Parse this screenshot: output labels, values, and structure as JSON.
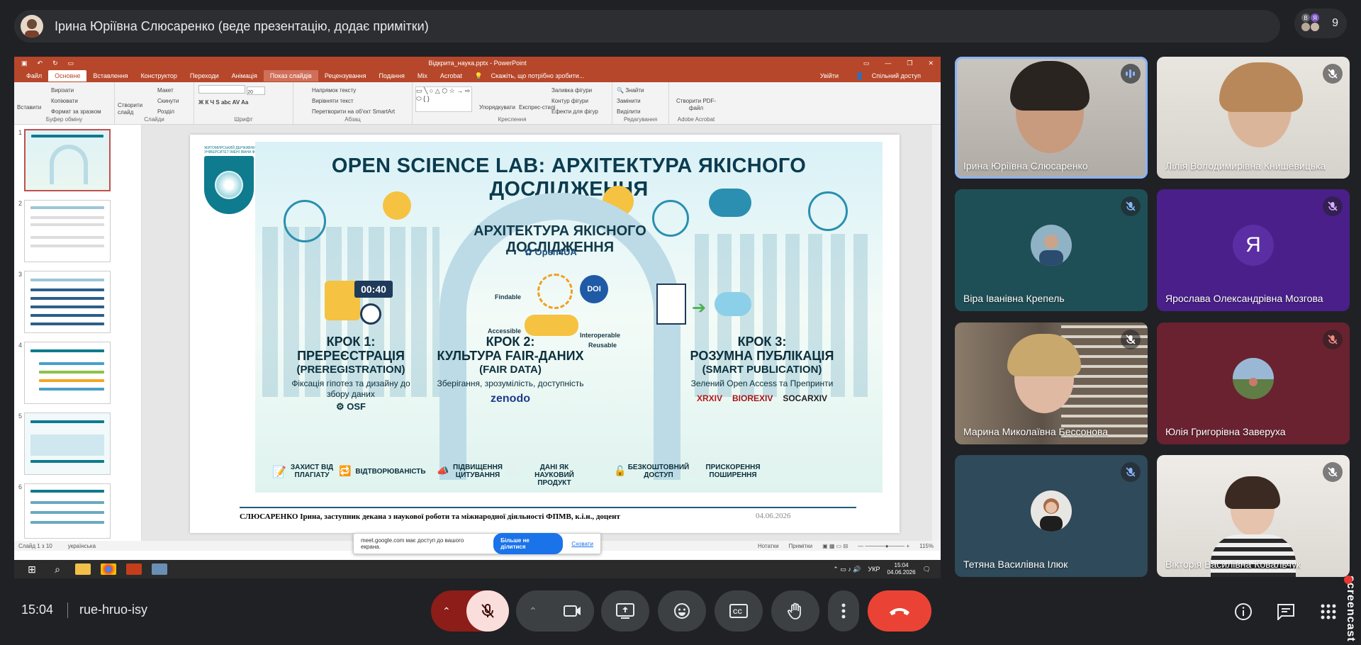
{
  "meet": {
    "presenter_title": "Ірина Юріївна Слюсаренко (веде презентацію, додає примітки)",
    "participant_count": "9",
    "participant_initials": [
      "В",
      "Я"
    ],
    "time": "15:04",
    "meeting_code": "rue-hruo-isy"
  },
  "tiles": [
    {
      "name": "Ірина Юріївна Слюсаренко",
      "status": "speaking"
    },
    {
      "name": "Лілія Володимирівна Книшевицька",
      "status": "muted"
    },
    {
      "name": "Віра Іванівна Крепель",
      "status": "muted"
    },
    {
      "name": "Ярослава Олександрівна Мозгова",
      "status": "muted",
      "initial": "Я"
    },
    {
      "name": "Марина Миколаївна Бессонова",
      "status": "muted"
    },
    {
      "name": "Юлія Григорівна Заверуха",
      "status": "muted"
    },
    {
      "name": "Тетяна Василівна Ілюк",
      "status": "muted"
    },
    {
      "name": "Вікторія Василівна Ковальчук",
      "status": "muted"
    }
  ],
  "screencast_label": "screencast",
  "powerpoint": {
    "window_title": "Відкрита_наука.pptx - PowerPoint",
    "menu": [
      "Файл",
      "Основне",
      "Вставлення",
      "Конструктор",
      "Переходи",
      "Анімація",
      "Показ слайдів",
      "Рецензування",
      "Подання",
      "Mix",
      "Acrobat"
    ],
    "tell_me": "Скажіть, що потрібно зробити...",
    "signin": "Увійти",
    "share": "Спільний доступ",
    "ribbon": {
      "clipboard": {
        "label": "Буфер обміну",
        "paste": "Вставити",
        "cut": "Вирізати",
        "copy": "Копіювати",
        "format": "Формат за зразком"
      },
      "slides": {
        "label": "Слайди",
        "new": "Створити слайд",
        "layout": "Макет",
        "reset": "Скинути",
        "section": "Розділ"
      },
      "font": {
        "label": "Шрифт",
        "size": "20"
      },
      "paragraph": {
        "label": "Абзац",
        "dir": "Напрямок тексту",
        "align": "Вирівняти текст",
        "smartart": "Перетворити на об'єкт SmartArt"
      },
      "drawing": {
        "label": "Креслення",
        "arrange": "Упорядкувати",
        "styles": "Експрес-стилі",
        "fill": "Заливка фігури",
        "outline": "Контур фігури",
        "effects": "Ефекти для фігур"
      },
      "editing": {
        "label": "Редагування",
        "find": "Знайти",
        "replace": "Замінити",
        "select": "Виділити"
      },
      "acrobat": {
        "label": "Adobe Acrobat",
        "create": "Створити PDF-файл"
      }
    },
    "thumb_numbers": [
      "1",
      "2",
      "3",
      "4",
      "5",
      "6"
    ],
    "status_slide": "Слайд 1 з 10",
    "status_lang": "українська",
    "status_notes": "Нотатки",
    "status_comments": "Примітки",
    "status_zoom": "115%",
    "share_notice": {
      "text": "meet.google.com має доступ до вашого екрана.",
      "stop": "Більше не ділитися",
      "hide": "Сховати"
    },
    "tray_lang": "УКР",
    "tray_time": "15:04",
    "tray_date": "04.06.2026"
  },
  "slide": {
    "logo_caption": "ЖИТОМИРСЬКИЙ ДЕРЖАВНИЙ УНІВЕРСИТЕТ ІМЕНІ ІВАНА ФРАНКА",
    "title": "OPEN SCIENCE LAB: АРХІТЕКТУРА ЯКІСНОГО ДОСЛІДЖЕННЯ",
    "arch_label": "АРХІТЕКТУРА ЯКІСНОГО ДОСЛІДЖЕННЯ",
    "brand": "Open4UA",
    "timer": "00:40",
    "fair_words": [
      "Findable",
      "Accessible",
      "Interoperable",
      "Reusable"
    ],
    "doi": "DOI",
    "step1": {
      "h1": "КРОК 1:",
      "h2": "ПРЕРЕЄСТРАЦІЯ",
      "h3": "(PREREGISTRATION)",
      "sub": "Фіксація гіпотез та дизайну до збору даних",
      "tool": "OSF"
    },
    "step2": {
      "h1": "КРОК 2:",
      "h2": "КУЛЬТУРА FAIR-ДАНИХ",
      "h3": "(FAIR DATA)",
      "sub": "Зберігання, зрозумілість, доступність",
      "tool": "zenodo"
    },
    "step3": {
      "h1": "КРОК 3:",
      "h2": "РОЗУМНА ПУБЛІКАЦІЯ",
      "h3": "(SMART PUBLICATION)",
      "sub": "Зелений Open Access та Препринти",
      "tools": [
        "XRXIV",
        "BIOREXIV",
        "SOCARXIV"
      ]
    },
    "tags": [
      "ЗАХИСТ ВІД ПЛАГІАТУ",
      "ВІДТВОРЮВАНІСТЬ",
      "ПІДВИЩЕННЯ ЦИТУВАННЯ",
      "ДАНІ ЯК НАУКОВИЙ ПРОДУКТ",
      "БЕЗКОШТОВНИЙ ДОСТУП",
      "ПРИСКОРЕННЯ ПОШИРЕННЯ"
    ],
    "footer": "СЛЮСАРЕНКО Ірина, заступник декана з наукової роботи та міжнародної діяльності ФПМВ, к.і.н., доцент",
    "date": "04.06.2026"
  },
  "colors": {
    "accent": "#8ab4f8",
    "end_call": "#ea4335",
    "mic_off": "#f9dedc",
    "ppt_red": "#b7472a"
  }
}
